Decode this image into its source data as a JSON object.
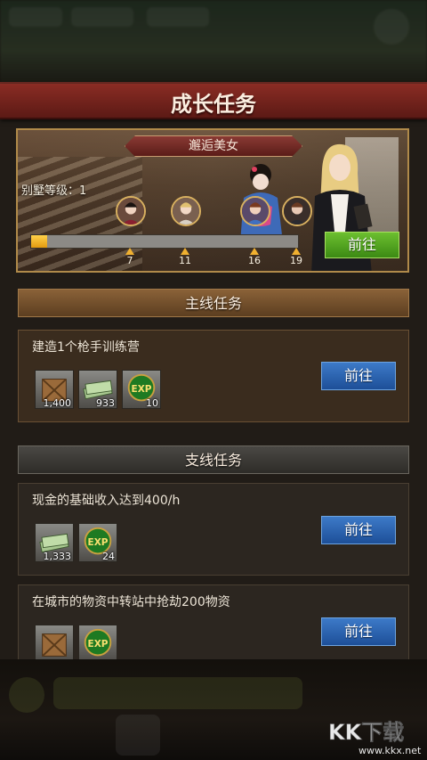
{
  "header": {
    "title": "成长任务"
  },
  "event": {
    "label": "邂逅美女",
    "villa_level": "别墅等级：1",
    "progress_fraction": 0.06,
    "milestones": [
      "7",
      "11",
      "16",
      "19"
    ],
    "go_label": "前往"
  },
  "main_section": {
    "title": "主线任务",
    "task": {
      "description": "建造1个枪手训练营",
      "rewards": [
        {
          "icon": "crate-icon",
          "qty": "1,400"
        },
        {
          "icon": "cash-icon",
          "qty": "933"
        },
        {
          "icon": "exp-icon",
          "qty": "10",
          "text": "EXP"
        }
      ],
      "go_label": "前往"
    }
  },
  "side_section": {
    "title": "支线任务",
    "tasks": [
      {
        "description": "现金的基础收入达到400/h",
        "rewards": [
          {
            "icon": "cash-icon",
            "qty": "1,333"
          },
          {
            "icon": "exp-icon",
            "qty": "24",
            "text": "EXP"
          }
        ],
        "go_label": "前往"
      },
      {
        "description": "在城市的物资中转站中抢劫200物资",
        "rewards": [
          {
            "icon": "crate-icon",
            "qty": ""
          },
          {
            "icon": "exp-icon",
            "qty": "",
            "text": "EXP"
          }
        ],
        "go_label": "前往"
      }
    ]
  },
  "watermark": {
    "text": "KK下载",
    "url": "www.kkx.net"
  },
  "colors": {
    "title_red": "#8a2c24",
    "green_button": "#4ea420",
    "blue_button": "#2a62b0",
    "progress_gold": "#f0b030"
  }
}
